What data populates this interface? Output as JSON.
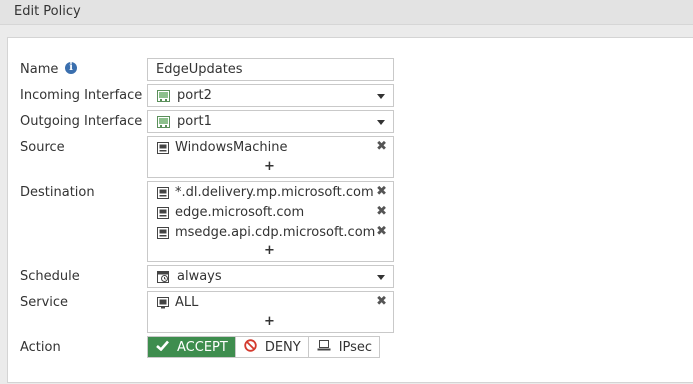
{
  "window": {
    "title": "Edit Policy"
  },
  "form": {
    "name": {
      "label": "Name",
      "value": "EdgeUpdates",
      "info_icon": "info-icon"
    },
    "incoming_interface": {
      "label": "Incoming Interface",
      "value": "port2",
      "icon": "interface-port-icon"
    },
    "outgoing_interface": {
      "label": "Outgoing Interface",
      "value": "port1",
      "icon": "interface-port-icon"
    },
    "source": {
      "label": "Source",
      "entries": [
        "WindowsMachine"
      ],
      "add": "+",
      "remove": "✖"
    },
    "destination": {
      "label": "Destination",
      "entries": [
        "*.dl.delivery.mp.microsoft.com",
        "edge.microsoft.com",
        "msedge.api.cdp.microsoft.com"
      ],
      "add": "+",
      "remove": "✖"
    },
    "schedule": {
      "label": "Schedule",
      "value": "always",
      "icon": "schedule-calendar-icon"
    },
    "service": {
      "label": "Service",
      "entries": [
        "ALL"
      ],
      "add": "+",
      "remove": "✖"
    },
    "action": {
      "label": "Action",
      "options": [
        {
          "label": "ACCEPT",
          "icon": "checkmark-icon",
          "selected": true
        },
        {
          "label": "DENY",
          "icon": "deny-circle-icon",
          "selected": false
        },
        {
          "label": "IPsec",
          "icon": "laptop-icon",
          "selected": false
        }
      ]
    }
  },
  "colors": {
    "accept_active": "#3e8d4e",
    "deny_icon": "#d43a2e",
    "info_icon": "#3a6fae",
    "port_icon": "#5a8f5a"
  }
}
